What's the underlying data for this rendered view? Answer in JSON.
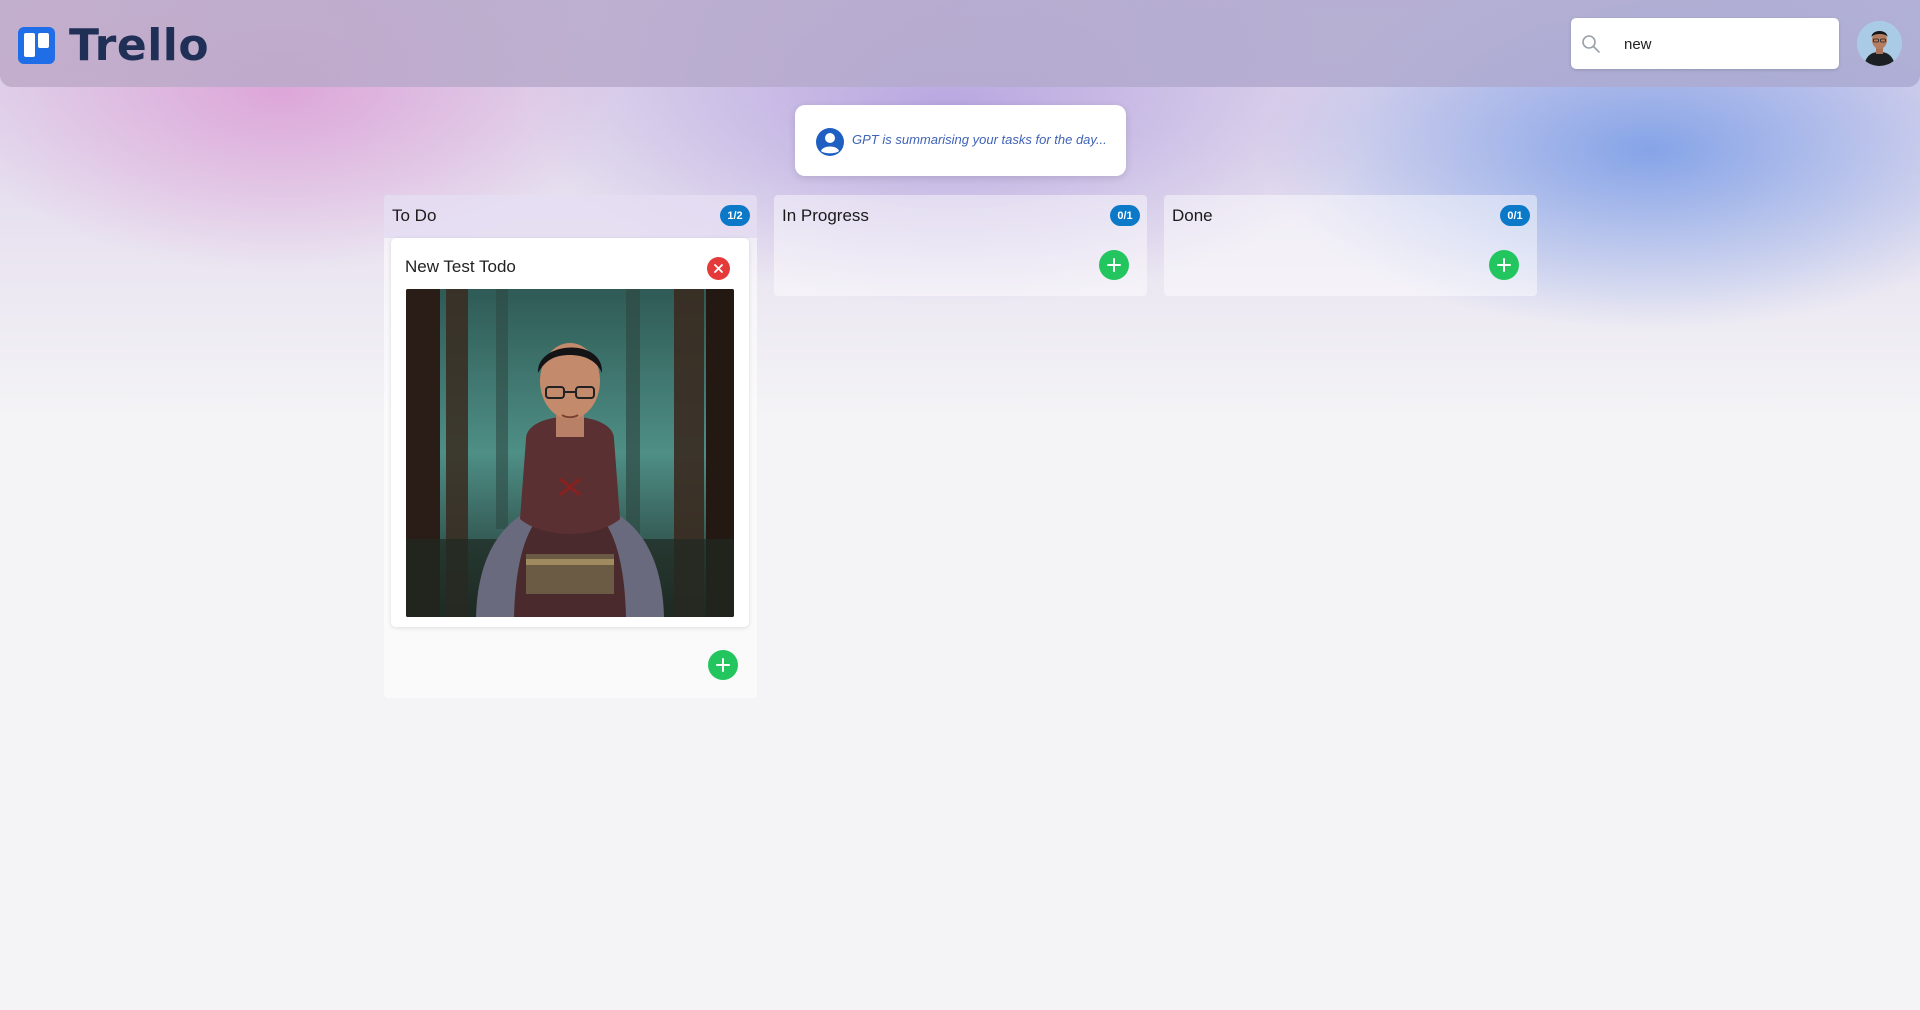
{
  "app": {
    "name": "Trello"
  },
  "search": {
    "value": "new",
    "placeholder": "Search",
    "icon": "search-icon"
  },
  "user": {
    "avatar_icon": "user-avatar"
  },
  "summary": {
    "text": "GPT is summarising your tasks for the day...",
    "icon": "user-circle-icon",
    "color": "#3f63b5"
  },
  "columns": [
    {
      "title": "To Do",
      "count": "1/2",
      "cards": [
        {
          "title": "New Test Todo",
          "image": "character-portrait"
        }
      ]
    },
    {
      "title": "In Progress",
      "count": "0/1",
      "cards": []
    },
    {
      "title": "Done",
      "count": "0/1",
      "cards": []
    }
  ],
  "colors": {
    "badge": "#0b79c8",
    "add": "#22c55e",
    "remove": "#e53a3a",
    "brand": "#1f6ee8"
  }
}
